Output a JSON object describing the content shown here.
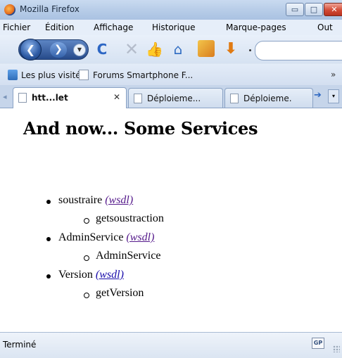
{
  "titlebar": {
    "title": "Mozilla Firefox",
    "buttons": {
      "minimize": "▭",
      "maximize": "□",
      "close": "✕"
    }
  },
  "menubar": {
    "items": [
      "Fichier",
      "Édition",
      "Affichage",
      "Historique",
      "Marque-pages",
      "Out"
    ]
  },
  "toolbar": {
    "back_glyph": "❮",
    "forward_glyph": "❯",
    "history_glyph": "▼",
    "reload_glyph": "C",
    "stop_glyph": "✕",
    "home_glyph": "⌂",
    "download_glyph": "⬇",
    "thumb_glyph": "👍"
  },
  "bookmarks": {
    "items": [
      "Les plus visités",
      "Forums Smartphone F..."
    ],
    "overflow": "»"
  },
  "tabs": {
    "scroll_left": "◂",
    "items": [
      {
        "label": "htt...let",
        "close": "✕"
      },
      {
        "label": "Déploieme..."
      },
      {
        "label": "Déploieme."
      }
    ],
    "scroll_right": "➔",
    "list": "▾"
  },
  "content": {
    "heading": "And now... Some Services",
    "services": [
      {
        "name": "soustraire",
        "link": "(wsdl)",
        "operation": "getsoustraction"
      },
      {
        "name": "AdminService",
        "link": "(wsdl)",
        "operation": "AdminService"
      },
      {
        "name": "Version",
        "link": "(wsdl)",
        "operation": "getVersion"
      }
    ]
  },
  "statusbar": {
    "text": "Terminé",
    "gp_label": "GP"
  }
}
